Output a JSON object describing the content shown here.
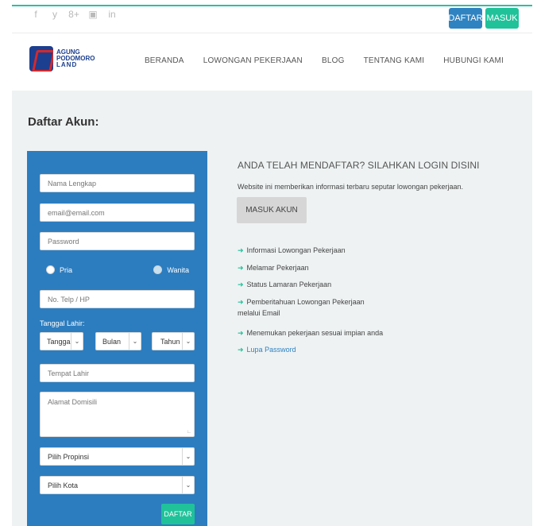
{
  "social": {
    "icons": [
      "facebook-icon",
      "twitter-icon",
      "google-plus-icon",
      "youtube-icon",
      "linkedin-icon"
    ],
    "glyphs": [
      "f",
      "y",
      "8+",
      "▣",
      "in"
    ]
  },
  "topbar": {
    "daftar_label": "DAFTAR",
    "masuk_label": "MASUK"
  },
  "logo": {
    "line1": "AGUNG",
    "line2": "PODOMORO",
    "line3": "LAND"
  },
  "nav": {
    "items": [
      "BERANDA",
      "LOWONGAN PEKERJAAN",
      "BLOG",
      "TENTANG KAMI",
      "HUBUNGI KAMI"
    ]
  },
  "page": {
    "title": "Daftar Akun:"
  },
  "form": {
    "nama_placeholder": "Nama Lengkap",
    "email_placeholder": "email@email.com",
    "password_placeholder": "Password",
    "gender_options": [
      "Pria",
      "Wanita"
    ],
    "phone_placeholder": "No. Telp / HP",
    "tanggal_label": "Tanggal Lahir:",
    "tanggal_options": [
      "Tangga",
      "Bulan",
      "Tahun"
    ],
    "tempat_placeholder": "Tempat Lahir",
    "alamat_placeholder": "Alamat Domisili",
    "propinsi": "Pilih Propinsi",
    "kota": "Pilih Kota",
    "submit_label": "DAFTAR"
  },
  "right": {
    "title": "ANDA TELAH MENDAFTAR? SILAHKAN LOGIN DISINI",
    "description": "Website ini memberikan informasi terbaru seputar lowongan pekerjaan.",
    "login_button": "MASUK AKUN",
    "features": [
      "Informasi Lowongan Pekerjaan",
      "Melamar Pekerjaan",
      "Status Lamaran Pekerjaan",
      "Pemberitahuan Lowongan Pekerjaan melalui Email",
      "Menemukan pekerjaan sesuai impian anda"
    ],
    "lupa_password": "Lupa Password"
  },
  "colors": {
    "accent_green": "#20c29a",
    "accent_blue": "#2f83c1",
    "panel_blue": "#2c7dbf"
  }
}
